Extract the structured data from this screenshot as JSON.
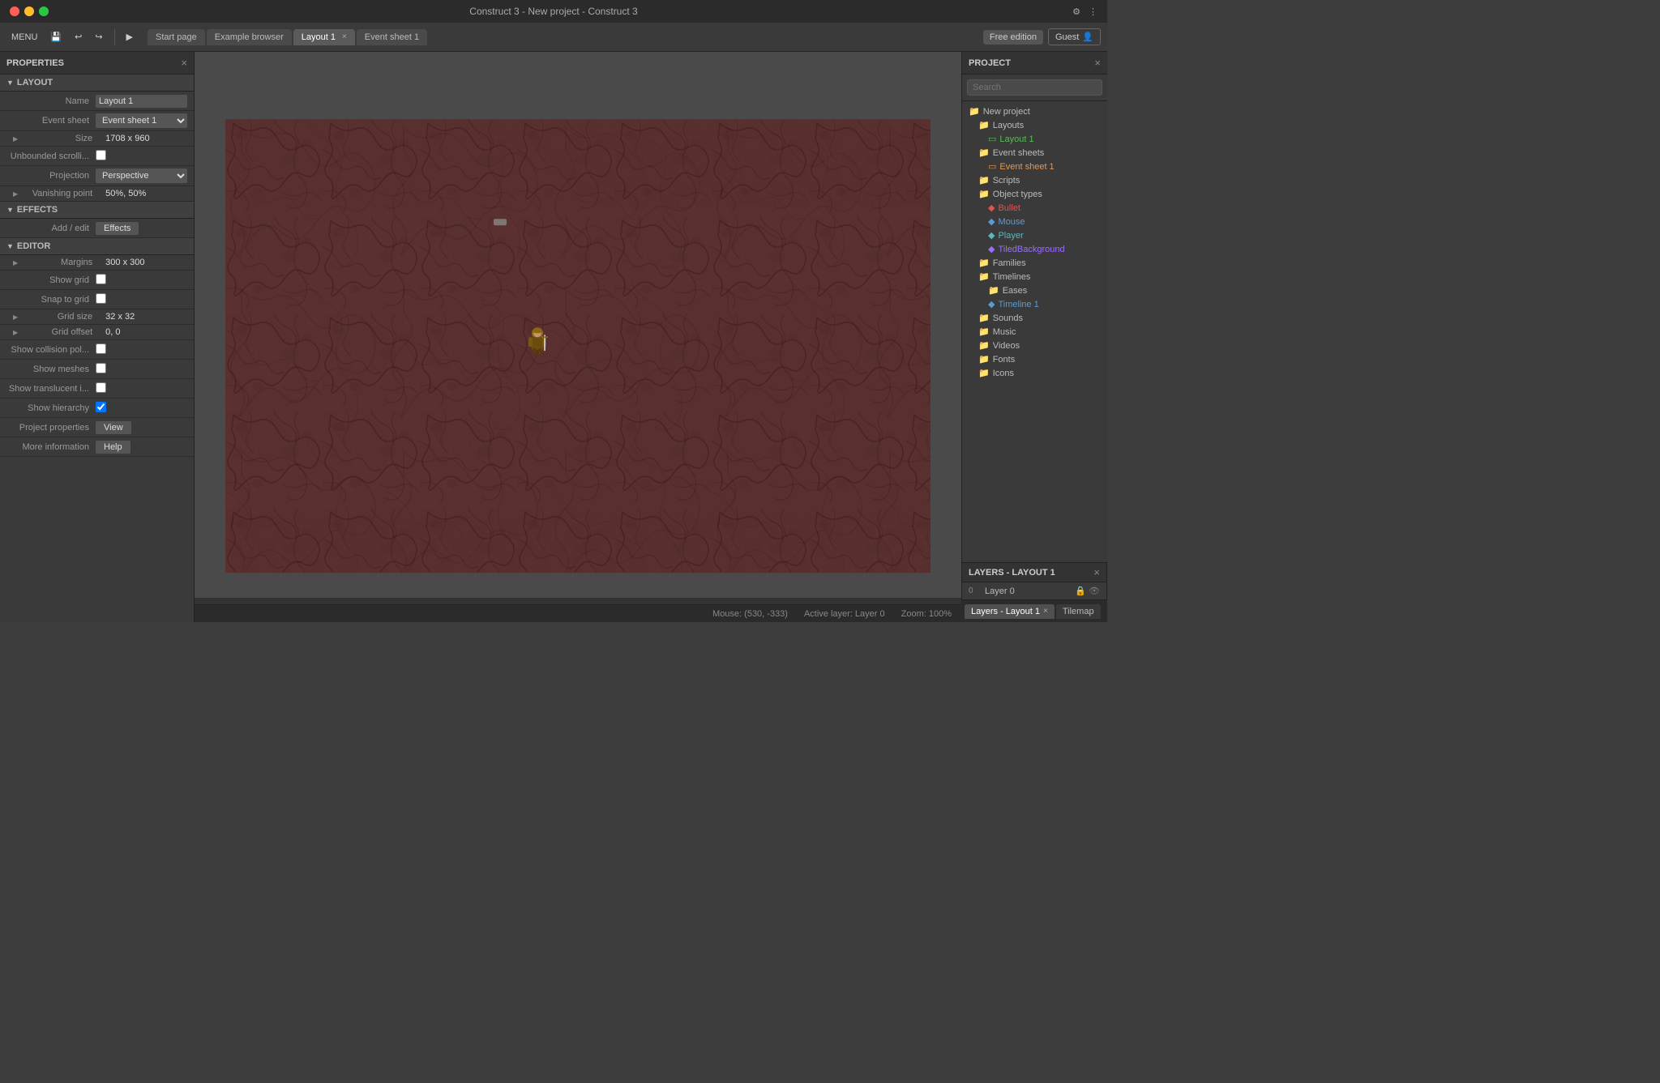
{
  "window": {
    "title": "Construct 3 - New project - Construct 3",
    "close_label": "×",
    "min_label": "−",
    "max_label": "+"
  },
  "toolbar": {
    "menu_label": "MENU",
    "save_icon": "💾",
    "undo_icon": "↩",
    "redo_icon": "↪",
    "play_icon": "▶",
    "tabs": [
      {
        "id": "start",
        "label": "Start page",
        "active": false,
        "closable": false
      },
      {
        "id": "browser",
        "label": "Example browser",
        "active": false,
        "closable": false
      },
      {
        "id": "layout1",
        "label": "Layout 1",
        "active": true,
        "closable": true
      },
      {
        "id": "events1",
        "label": "Event sheet 1",
        "active": false,
        "closable": false
      }
    ],
    "free_edition": "Free edition",
    "guest": "Guest"
  },
  "properties": {
    "panel_title": "PROPERTIES",
    "sections": {
      "layout": {
        "title": "LAYOUT",
        "name_label": "Name",
        "name_value": "Layout 1",
        "event_sheet_label": "Event sheet",
        "event_sheet_value": "Event sheet 1",
        "size_label": "Size",
        "size_value": "1708 x 960",
        "unbounded_label": "Unbounded scrolli...",
        "projection_label": "Projection",
        "projection_value": "Perspective",
        "vanishing_label": "Vanishing point",
        "vanishing_value": "50%, 50%"
      },
      "effects": {
        "title": "EFFECTS",
        "add_edit_label": "Add / edit",
        "effects_btn": "Effects"
      },
      "editor": {
        "title": "EDITOR",
        "margins_label": "Margins",
        "margins_value": "300 x 300",
        "show_grid_label": "Show grid",
        "snap_to_grid_label": "Snap to grid",
        "grid_size_label": "Grid size",
        "grid_size_value": "32 x 32",
        "grid_offset_label": "Grid offset",
        "grid_offset_value": "0, 0",
        "collision_label": "Show collision pol...",
        "meshes_label": "Show meshes",
        "translucent_label": "Show translucent i...",
        "hierarchy_label": "Show hierarchy",
        "project_props_label": "Project properties",
        "project_props_btn": "View",
        "more_info_label": "More information",
        "more_info_btn": "Help"
      }
    }
  },
  "project": {
    "panel_title": "PROJECT",
    "search_placeholder": "Search",
    "tree": [
      {
        "type": "folder",
        "label": "New project",
        "indent": 0,
        "expanded": true
      },
      {
        "type": "folder",
        "label": "Layouts",
        "indent": 1,
        "expanded": true
      },
      {
        "type": "file",
        "label": "Layout 1",
        "indent": 2,
        "color": "green",
        "active": true
      },
      {
        "type": "folder",
        "label": "Event sheets",
        "indent": 1,
        "expanded": true
      },
      {
        "type": "file",
        "label": "Event sheet 1",
        "indent": 2,
        "color": "orange"
      },
      {
        "type": "folder",
        "label": "Scripts",
        "indent": 1,
        "expanded": false
      },
      {
        "type": "folder",
        "label": "Object types",
        "indent": 1,
        "expanded": true
      },
      {
        "type": "file",
        "label": "Bullet",
        "indent": 2,
        "color": "red"
      },
      {
        "type": "file",
        "label": "Mouse",
        "indent": 2,
        "color": "blue"
      },
      {
        "type": "file",
        "label": "Player",
        "indent": 2,
        "color": "teal"
      },
      {
        "type": "file",
        "label": "TiledBackground",
        "indent": 2,
        "color": "purple"
      },
      {
        "type": "folder",
        "label": "Families",
        "indent": 1,
        "expanded": false
      },
      {
        "type": "folder",
        "label": "Timelines",
        "indent": 1,
        "expanded": true
      },
      {
        "type": "folder",
        "label": "Eases",
        "indent": 2,
        "expanded": false
      },
      {
        "type": "file",
        "label": "Timeline 1",
        "indent": 2,
        "color": "blue"
      },
      {
        "type": "folder",
        "label": "Sounds",
        "indent": 1,
        "expanded": false
      },
      {
        "type": "folder",
        "label": "Music",
        "indent": 1,
        "expanded": false
      },
      {
        "type": "folder",
        "label": "Videos",
        "indent": 1,
        "expanded": false
      },
      {
        "type": "folder",
        "label": "Fonts",
        "indent": 1,
        "expanded": false
      },
      {
        "type": "folder",
        "label": "Icons",
        "indent": 1,
        "expanded": false
      }
    ]
  },
  "layers": {
    "panel_title": "LAYERS - LAYOUT 1",
    "items": [
      {
        "index": "0",
        "name": "Layer 0"
      }
    ]
  },
  "status": {
    "mouse": "Mouse: (530, -333)",
    "active_layer": "Active layer: Layer 0",
    "zoom": "Zoom: 100%"
  },
  "bottom_tabs": [
    {
      "label": "Layers - Layout 1",
      "active": true,
      "closable": true
    },
    {
      "label": "Tilemap",
      "active": false,
      "closable": false
    }
  ]
}
